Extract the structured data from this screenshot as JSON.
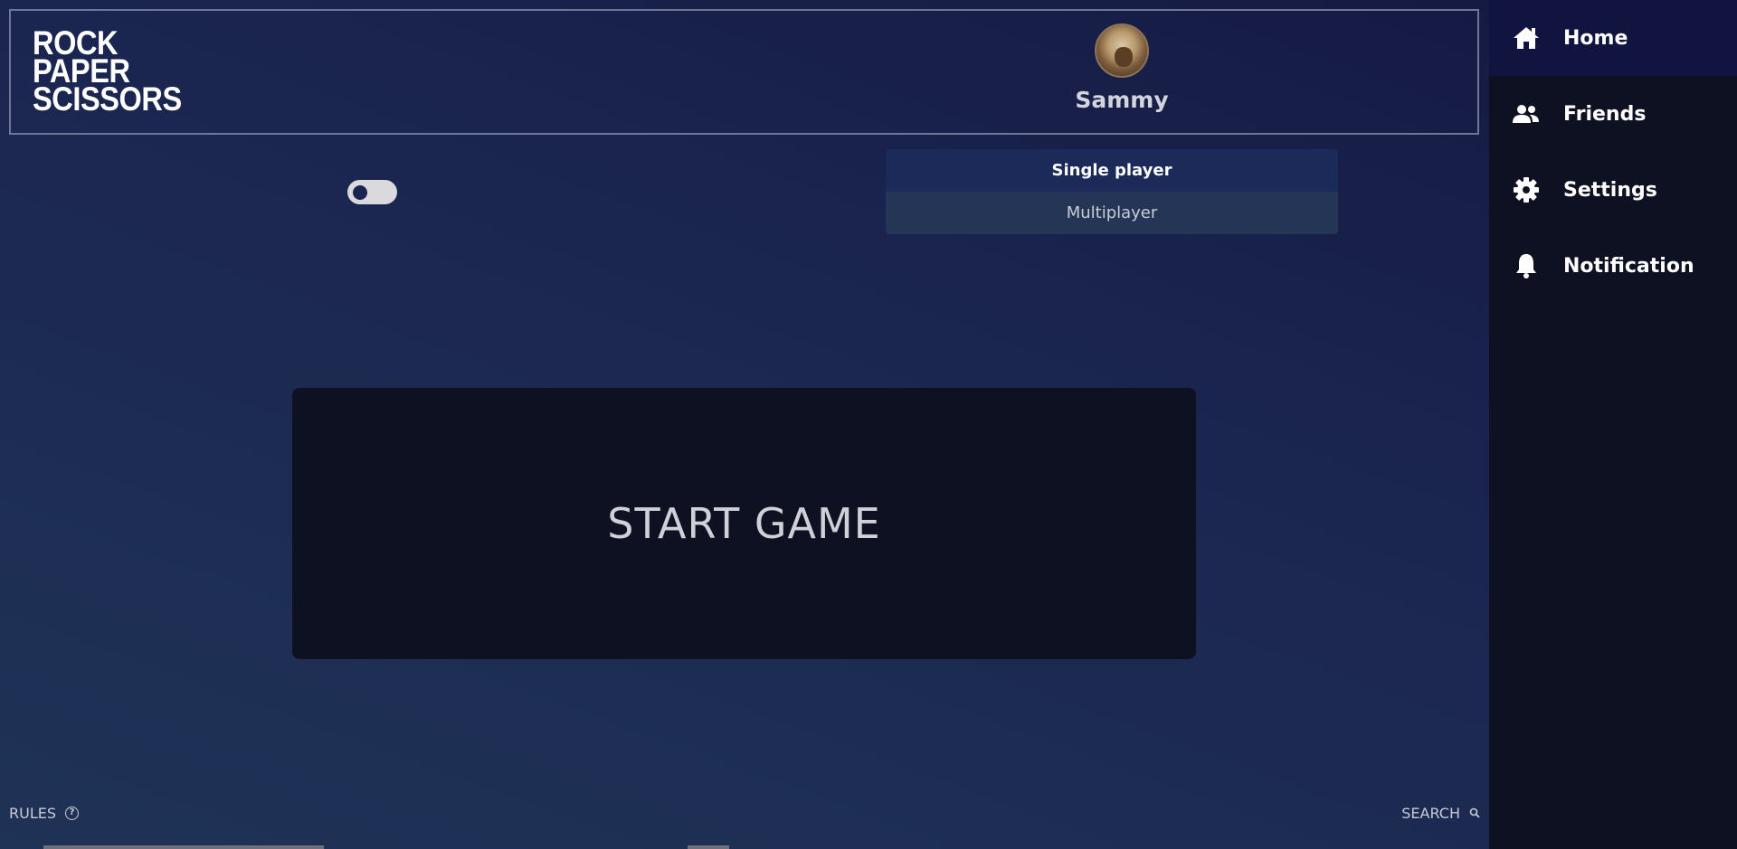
{
  "app": {
    "logo_lines": [
      "ROCK",
      "PAPER",
      "SCISSORS"
    ]
  },
  "profile": {
    "username": "Sammy"
  },
  "mode_menu": {
    "items": [
      {
        "label": "Single player",
        "selected": true
      },
      {
        "label": "Multiplayer",
        "selected": false
      }
    ]
  },
  "toggle": {
    "on": false
  },
  "start_button": {
    "label": "START GAME"
  },
  "footer": {
    "rules_label": "RULES",
    "search_label": "SEARCH"
  },
  "sidebar": {
    "items": [
      {
        "label": "Home",
        "icon": "home-icon",
        "active": true
      },
      {
        "label": "Friends",
        "icon": "friends-icon",
        "active": false
      },
      {
        "label": "Settings",
        "icon": "gear-icon",
        "active": false
      },
      {
        "label": "Notification",
        "icon": "bell-icon",
        "active": false
      }
    ]
  },
  "colors": {
    "sidebar_bg": "#0e1122",
    "sidebar_active": "#121440",
    "main_gradient_start": "#151a44",
    "main_gradient_end": "#1f3356"
  }
}
